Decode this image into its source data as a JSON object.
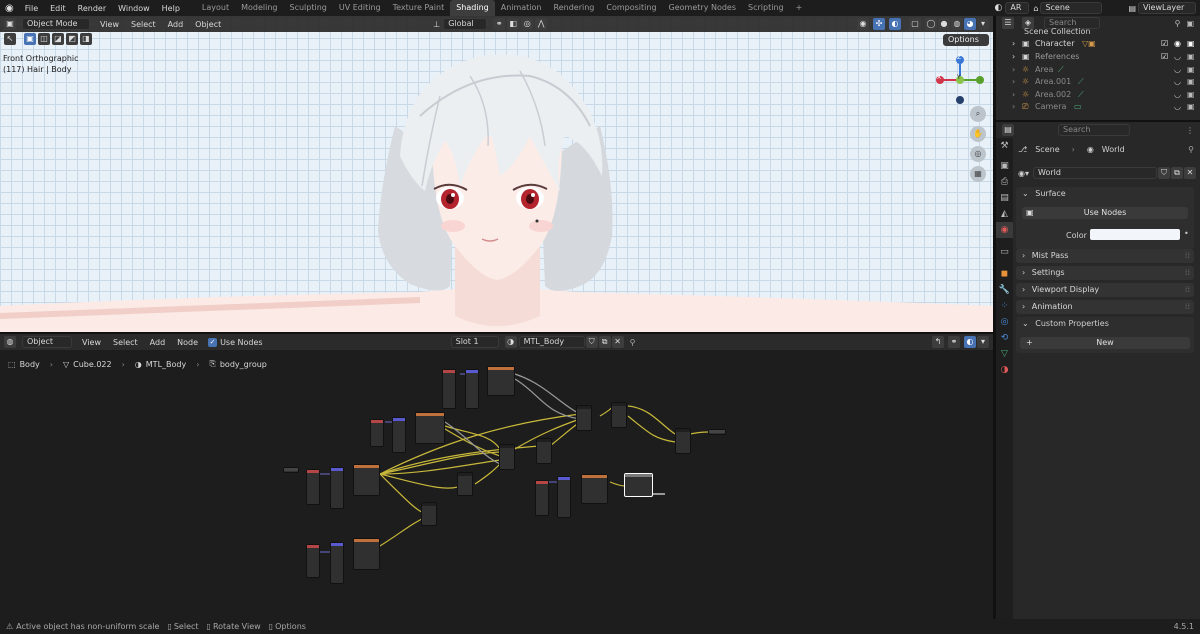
{
  "topbar": {
    "menus": [
      "File",
      "Edit",
      "Render",
      "Window",
      "Help"
    ],
    "workspaces": [
      "Layout",
      "Modeling",
      "Sculpting",
      "UV Editing",
      "Texture Paint",
      "Shading",
      "Animation",
      "Rendering",
      "Compositing",
      "Geometry Nodes",
      "Scripting"
    ],
    "active_workspace": "Shading",
    "add_tab": "+",
    "language": "AR",
    "scene": "Scene",
    "view_layer": "ViewLayer"
  },
  "viewport": {
    "mode": "Object Mode",
    "menus": [
      "View",
      "Select",
      "Add",
      "Object"
    ],
    "orientation": "Global",
    "options_label": "Options",
    "view_name": "Front Orthographic",
    "view_info": "(117) Hair | Body",
    "gizmo_axes": [
      "Z",
      "Y",
      "X"
    ],
    "background_color": "#e9f1f8"
  },
  "node_editor": {
    "editor_type": "Object",
    "menus": [
      "View",
      "Select",
      "Add",
      "Node"
    ],
    "use_nodes_label": "Use Nodes",
    "use_nodes_checked": true,
    "slot": "Slot 1",
    "material": "MTL_Body",
    "breadcrumb": [
      "Body",
      "Cube.022",
      "MTL_Body",
      "body_group"
    ]
  },
  "outliner": {
    "search_placeholder": "Search",
    "root": "Scene Collection",
    "items": [
      {
        "name": "Character",
        "dim": false
      },
      {
        "name": "References",
        "dim": false
      },
      {
        "name": "Area",
        "dim": true
      },
      {
        "name": "Area.001",
        "dim": true
      },
      {
        "name": "Area.002",
        "dim": true
      },
      {
        "name": "Camera",
        "dim": true
      }
    ]
  },
  "properties": {
    "search_placeholder": "Search",
    "breadcrumb": [
      "Scene",
      "World"
    ],
    "world_name": "World",
    "panels": {
      "surface": "Surface",
      "use_nodes_button": "Use Nodes",
      "color_label": "Color",
      "color_value": "#f2f6fb",
      "mist_pass": "Mist Pass",
      "settings": "Settings",
      "viewport_display": "Viewport Display",
      "animation": "Animation",
      "custom_properties": "Custom Properties",
      "new_button": "New"
    }
  },
  "statusbar": {
    "message": "Active object has non-uniform scale",
    "hint_select": "Select",
    "hint_rotate": "Rotate View",
    "hint_options": "Options",
    "version": "4.5.1"
  }
}
